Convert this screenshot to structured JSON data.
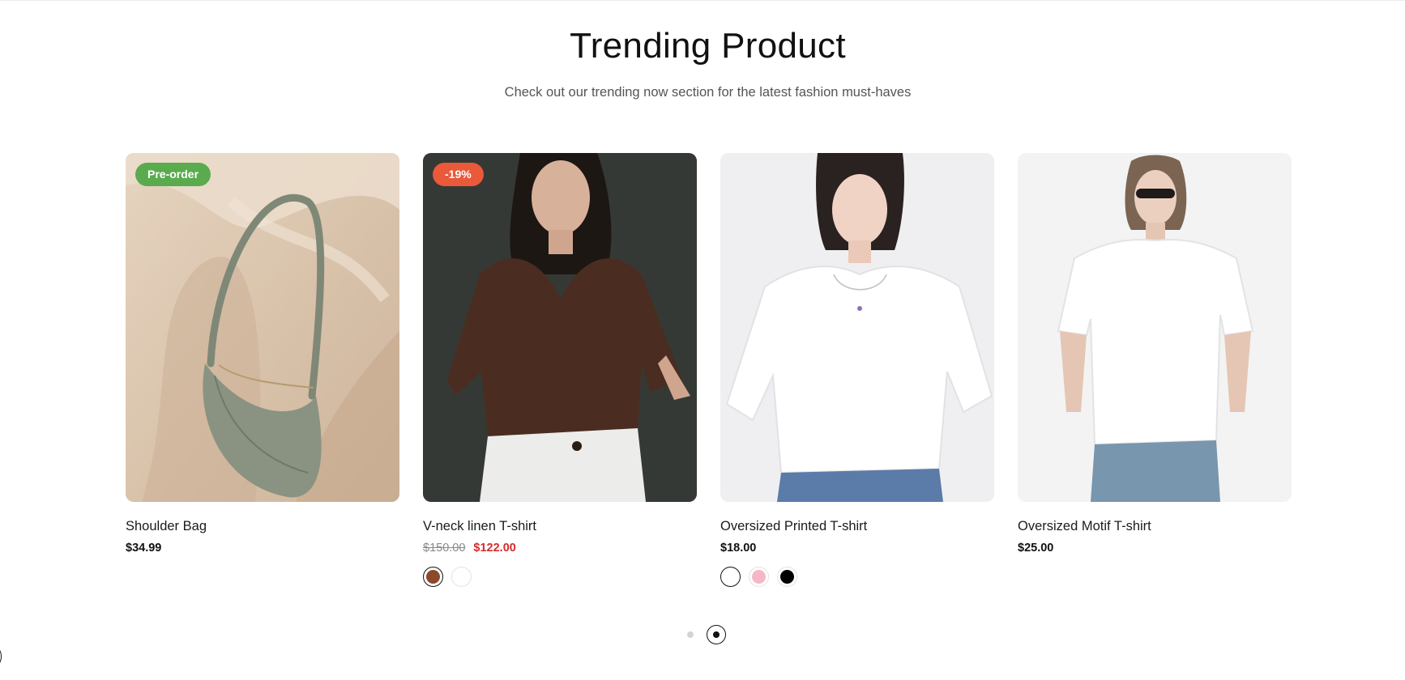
{
  "section": {
    "title": "Trending Product",
    "subtitle": "Check out our trending now section for the latest fashion must-haves"
  },
  "products": [
    {
      "name": "Shoulder Bag",
      "badge": "Pre-order",
      "price": "$34.99",
      "image_icon": "shoulder-bag-image",
      "swatches": []
    },
    {
      "name": "V-neck linen T-shirt",
      "badge": "-19%",
      "price_old": "$150.00",
      "price_new": "$122.00",
      "image_icon": "brown-vneck-tshirt-image",
      "swatches": [
        {
          "color": "#8b4a2b",
          "selected": true
        },
        {
          "color": "#ffffff",
          "selected": false
        }
      ]
    },
    {
      "name": "Oversized Printed T-shirt",
      "price": "$18.00",
      "image_icon": "white-oversized-tshirt-image",
      "swatches": [
        {
          "color": "#ffffff",
          "selected": true
        },
        {
          "color": "#f5b7c5",
          "selected": false
        },
        {
          "color": "#000000",
          "selected": false
        }
      ]
    },
    {
      "name": "Oversized Motif T-shirt",
      "price": "$25.00",
      "image_icon": "white-motif-tshirt-image",
      "swatches": []
    }
  ],
  "pagination": {
    "pages": 2,
    "current": 2
  },
  "colors": {
    "preorder_badge": "#5aab4e",
    "sale_badge": "#e9593a",
    "sale_price": "#d52b2b"
  }
}
